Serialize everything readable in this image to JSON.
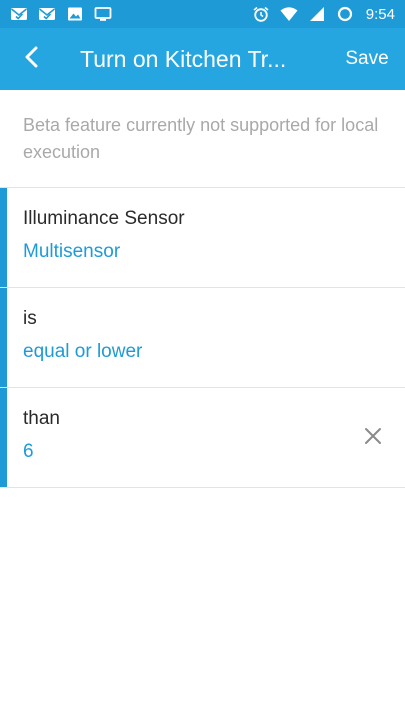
{
  "status_bar": {
    "time": "9:54",
    "icons_left": [
      "mail-check-icon",
      "mail-check-icon",
      "image-icon",
      "cast-screen-icon"
    ],
    "icons_right": [
      "alarm-icon",
      "wifi-icon",
      "signal-icon",
      "battery-circle-icon"
    ]
  },
  "app_bar": {
    "title": "Turn on Kitchen Tr...",
    "save_label": "Save",
    "back_icon": "chevron-left-icon"
  },
  "notice": {
    "text": "Beta feature currently not supported for local execution"
  },
  "conditions": [
    {
      "label": "Illuminance Sensor",
      "value": "Multisensor"
    },
    {
      "label": "is",
      "value": "equal or lower"
    },
    {
      "label": "than",
      "value": "6",
      "clear_icon": "close-icon"
    }
  ],
  "colors": {
    "status_bar": "#1e9bd7",
    "app_bar": "#26a6e0",
    "accent": "#1e9bd7",
    "notice_text": "#a9a9a9",
    "label_text": "#2a2a2a"
  }
}
